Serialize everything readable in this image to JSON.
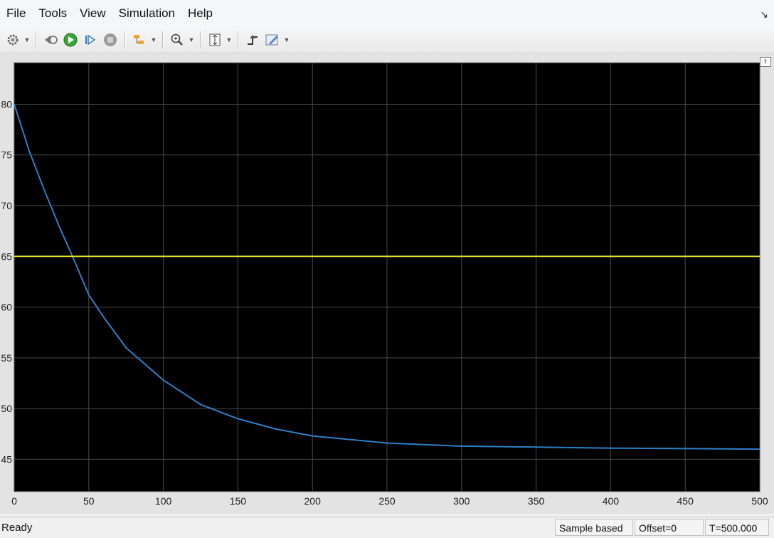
{
  "menu": {
    "items": [
      "File",
      "Tools",
      "View",
      "Simulation",
      "Help"
    ]
  },
  "toolbar": {
    "buttons": [
      "gear-icon",
      "step-back-icon",
      "run-icon",
      "step-forward-icon",
      "stop-icon",
      "highlight-icon",
      "zoom-icon",
      "fit-to-view-icon",
      "triggers-icon",
      "style-icon"
    ]
  },
  "status": {
    "ready": "Ready",
    "sample_based": "Sample based",
    "offset": "Offset=0",
    "time": "T=500.000"
  },
  "colors": {
    "plot_bg": "#000000",
    "grid": "#4a4a4a",
    "series_blue": "#2d7fc6",
    "series_yellow": "#e6e22e"
  },
  "chart_data": {
    "type": "line",
    "title": "",
    "xlabel": "",
    "ylabel": "",
    "xlim": [
      0,
      500
    ],
    "ylim": [
      41.8,
      84.1
    ],
    "grid": true,
    "xticks": [
      0,
      50,
      100,
      150,
      200,
      250,
      300,
      350,
      400,
      450,
      500
    ],
    "yticks": [
      45,
      50,
      55,
      60,
      65,
      70,
      75,
      80
    ],
    "series": [
      {
        "color": "#2d7fc6",
        "x": [
          0,
          10,
          20,
          30,
          40,
          50,
          60,
          75,
          100,
          125,
          150,
          175,
          200,
          250,
          300,
          350,
          400,
          450,
          500
        ],
        "y": [
          80,
          75.4,
          71.6,
          68.0,
          64.7,
          61.2,
          59.0,
          56.0,
          52.8,
          50.4,
          49.0,
          48.0,
          47.3,
          46.6,
          46.3,
          46.2,
          46.1,
          46.05,
          46.0
        ]
      },
      {
        "color": "#e6e22e",
        "x": [
          0,
          500
        ],
        "y": [
          65,
          65
        ]
      }
    ]
  }
}
